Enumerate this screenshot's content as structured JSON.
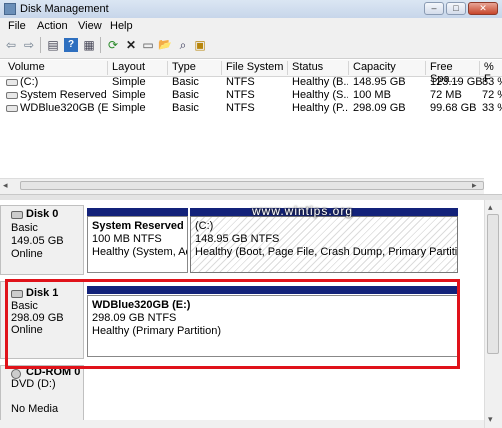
{
  "window": {
    "title": "Disk Management",
    "min": "–",
    "max": "□",
    "close": "✕"
  },
  "menu": [
    "File",
    "Action",
    "View",
    "Help"
  ],
  "toolbar": {
    "back": "⇦",
    "forward": "⇨",
    "list": "▤",
    "help": "?",
    "props": "▦",
    "refresh": "⟳",
    "delete": "✕",
    "open": "▭",
    "folder": "📂",
    "search": "⌕",
    "settings": "▣"
  },
  "volume_list": {
    "columns": [
      "Volume",
      "Layout",
      "Type",
      "File System",
      "Status",
      "Capacity",
      "Free Spa...",
      "% F"
    ],
    "rows": [
      [
        "(C:)",
        "Simple",
        "Basic",
        "NTFS",
        "Healthy (B...",
        "148.95 GB",
        "123.19 GB",
        "83 %"
      ],
      [
        "System Reserved",
        "Simple",
        "Basic",
        "NTFS",
        "Healthy (S...",
        "100 MB",
        "72 MB",
        "72 %"
      ],
      [
        "WDBlue320GB (E:)",
        "Simple",
        "Basic",
        "NTFS",
        "Healthy (P...",
        "298.09 GB",
        "99.68 GB",
        "33 %"
      ]
    ]
  },
  "disks": [
    {
      "name": "Disk 0",
      "type": "Basic",
      "size": "149.05 GB",
      "status": "Online",
      "partitions": [
        {
          "title": "System Reserved",
          "size": "100 MB NTFS",
          "status": "Healthy (System, Acti"
        },
        {
          "title": "(C:)",
          "size": "148.95 GB NTFS",
          "status": "Healthy (Boot, Page File, Crash Dump, Primary Partition)"
        }
      ]
    },
    {
      "name": "Disk 1",
      "type": "Basic",
      "size": "298.09 GB",
      "status": "Online",
      "partitions": [
        {
          "title": "WDBlue320GB  (E:)",
          "size": "298.09 GB NTFS",
          "status": "Healthy (Primary Partition)"
        }
      ]
    },
    {
      "name": "CD-ROM 0",
      "type": "DVD (D:)",
      "status": "No Media"
    }
  ],
  "watermark": "www.wintips.org",
  "scroll": {
    "left": "◂",
    "right": "▸",
    "up": "▴",
    "down": "▾"
  }
}
